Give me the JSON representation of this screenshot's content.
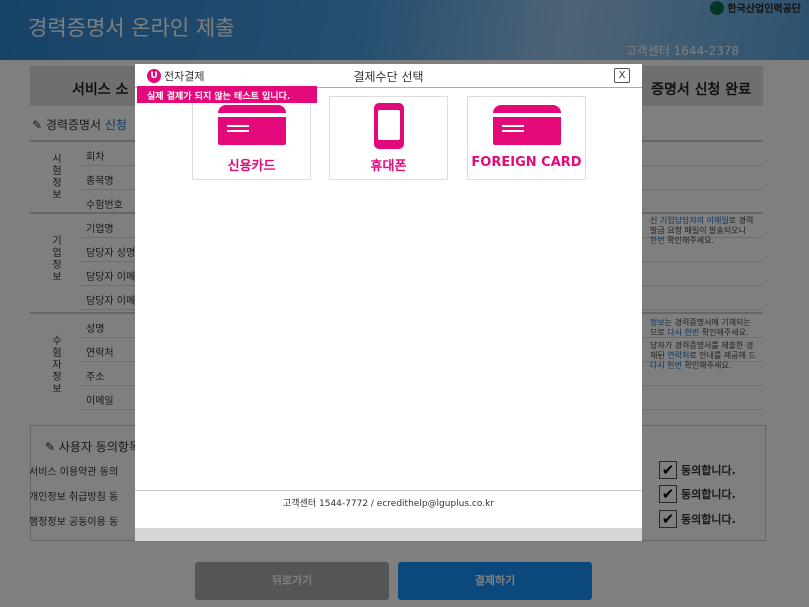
{
  "header": {
    "title": "경력증명서 온라인 제출",
    "customer_center": "고객센터 1644-2378",
    "org_logo": "한국산업인력공단"
  },
  "steps": {
    "first": "서비스 소",
    "last": "증명서 신청 완료"
  },
  "section": {
    "title_prefix": "경력증명서 ",
    "title_blue": "신청"
  },
  "groups": [
    {
      "label": "시험정보",
      "rows": [
        "회차",
        "종목명",
        "수험번호"
      ]
    },
    {
      "label": "기업정보",
      "rows": [
        "기업명",
        "담당자 성명",
        "담당자 이메",
        "담당자 이메"
      ]
    },
    {
      "label": "수험자정보",
      "rows": [
        "성명",
        "연락처",
        "주소",
        "이메일"
      ]
    }
  ],
  "notes": {
    "company": {
      "l1a": "신 ",
      "l1b": "기업담당자의 이메일",
      "l1c": "로 경력",
      "l2": "발급 요청 메일이 발송되오니",
      "l3a": "한번",
      "l3b": " 확인해주세요."
    },
    "applicant": {
      "l1a": "정보",
      "l1b": "는 경력증명서에 기재되는",
      "l2a": "므로 ",
      "l2b": "다시 한번",
      "l2c": " 확인해주세요.",
      "l3": "당자가 경력증명서를 제출한 경",
      "l4a": "재된 ",
      "l4b": "연락처",
      "l4c": "로 안내를 제공해 드",
      "l5a": "다시 한번",
      "l5b": " 확인해주세요."
    }
  },
  "agreement": {
    "title": "사용자 동의항목",
    "rows": [
      "서비스 이용약관 동의",
      "개인정보 취급방침 동",
      "행정정보 공동이용 동"
    ],
    "agree_label": "동의합니다.",
    "checked": [
      true,
      true,
      true
    ]
  },
  "buttons": {
    "back": "뒤로가기",
    "pay": "결제하기"
  },
  "modal": {
    "brand": "전자결제",
    "brand_icon": "U+",
    "title": "결제수단 선택",
    "close": "X",
    "test_notice": "실제 결제가 되지 않는 테스트 입니다.",
    "methods": [
      {
        "label": "신용카드",
        "icon": "credit-card-icon"
      },
      {
        "label": "휴대폰",
        "icon": "phone-icon"
      },
      {
        "label": "FOREIGN CARD",
        "icon": "credit-card-icon"
      }
    ],
    "footer": "고객센터 1544-7772 / ecredithelp@lguplus.co.kr"
  },
  "colors": {
    "accent": "#e4097a",
    "header_blue": "#2f86d0",
    "pay_blue": "#1793f8"
  }
}
